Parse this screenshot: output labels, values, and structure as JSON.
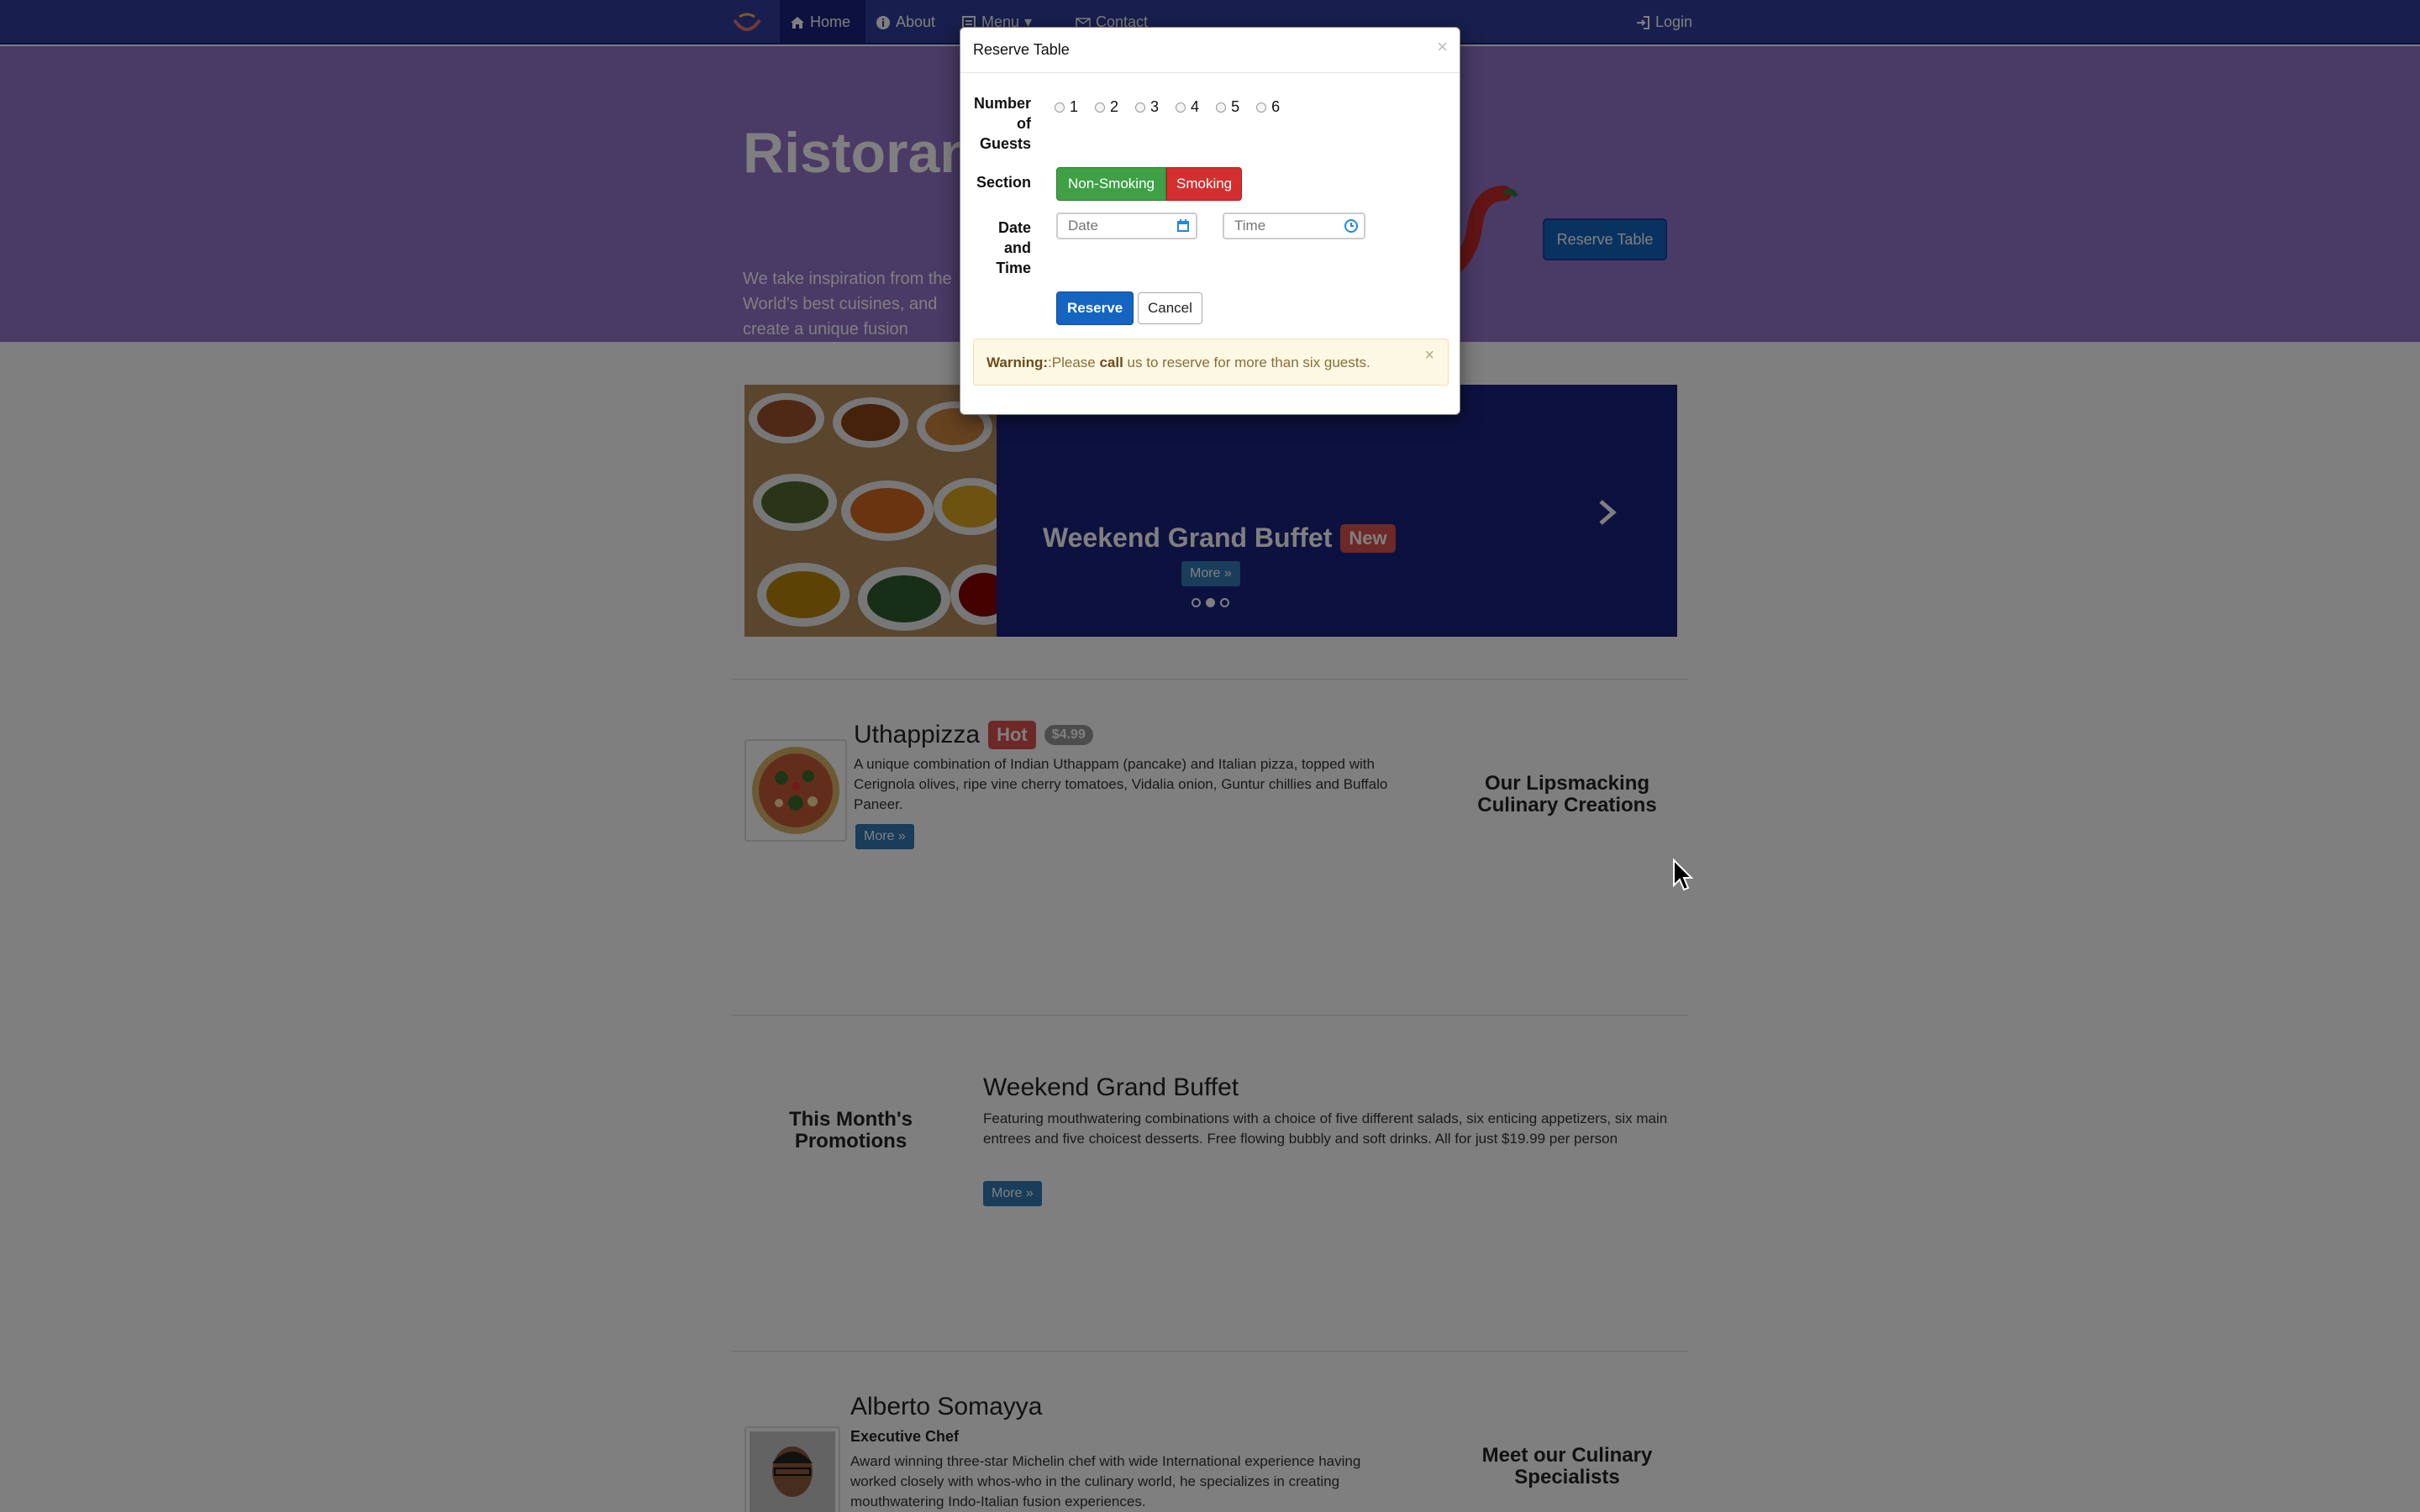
{
  "navbar": {
    "items": [
      {
        "label": "Home",
        "icon": "home-icon"
      },
      {
        "label": "About",
        "icon": "info-icon"
      },
      {
        "label": "Menu",
        "icon": "list-icon"
      },
      {
        "label": "Contact",
        "icon": "envelope-icon"
      }
    ],
    "login_label": "Login"
  },
  "jumbotron": {
    "title": "Ristorante con Fusion",
    "text": "We take inspiration from the World's best cuisines, and create a unique fusion experience. Our lipsmacking creations will tickle your culinary senses!",
    "reserve_button": "Reserve Table"
  },
  "carousel": {
    "caption": "Weekend Grand Buffet",
    "label": "New",
    "more": "More »",
    "active_slide": 2,
    "slide_count": 3
  },
  "dish": {
    "name": "Uthappizza",
    "label": "Hot",
    "price": "$4.99",
    "description": "A unique combination of Indian Uthappam (pancake) and Italian pizza, topped with Cerignola olives, ripe vine cherry tomatoes, Vidalia onion, Guntur chillies and Buffalo Paneer.",
    "more": "More »",
    "side_heading": "Our Lipsmacking Culinary Creations"
  },
  "promotion": {
    "side_heading": "This Month's Promotions",
    "name": "Weekend Grand Buffet",
    "description": "Featuring mouthwatering combinations with a choice of five different salads, six enticing appetizers, six main entrees and five choicest desserts. Free flowing bubbly and soft drinks. All for just $19.99 per person",
    "more": "More »"
  },
  "chef": {
    "name": "Alberto Somayya",
    "title": "Executive Chef",
    "description": "Award winning three-star Michelin chef with wide International experience having worked closely with whos-who in the culinary world, he specializes in creating mouthwatering Indo-Italian fusion experiences.",
    "side_heading": "Meet our Culinary Specialists"
  },
  "modal": {
    "title": "Reserve Table",
    "close": "×",
    "guests_label": "Number of Guests",
    "guest_options": [
      "1",
      "2",
      "3",
      "4",
      "5",
      "6"
    ],
    "section_label": "Section",
    "non_smoking": "Non-Smoking",
    "smoking": "Smoking",
    "datetime_label": "Date and Time",
    "date_placeholder": "Date",
    "time_placeholder": "Time",
    "reserve_button": "Reserve",
    "cancel_button": "Cancel",
    "warning": {
      "strong": "Warning:",
      "text1": ":Please ",
      "bold": "call",
      "text2": " us to reserve for more than six guests.",
      "close": "×"
    }
  },
  "colors": {
    "navbar": "#303F9F",
    "jumbotron": "#9575CD",
    "carousel": "#1A237E",
    "success": "#3FA046",
    "danger": "#D32F2F",
    "primary": "#1565C0",
    "warning_bg": "#FCF8E3"
  }
}
